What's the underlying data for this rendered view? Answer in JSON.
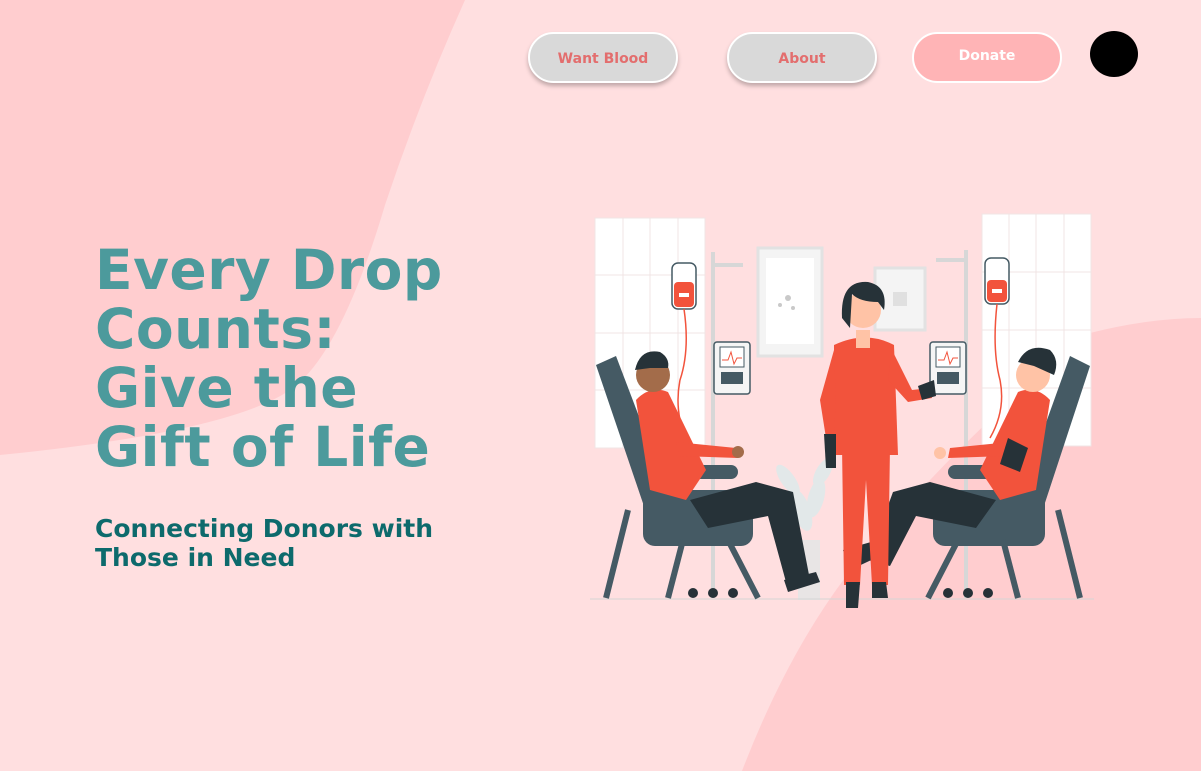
{
  "nav": {
    "want_blood_label": "Want Blood",
    "about_label": "About",
    "donate_label": "Donate"
  },
  "hero": {
    "headline_lines": [
      "Every Drop",
      "Counts:",
      "Give the",
      "Gift of Life"
    ],
    "subheadline_lines": [
      "Connecting Donors with",
      "Those in Need"
    ]
  },
  "illustration": {
    "name": "blood-donation-illustration",
    "blood_bag_label": ""
  },
  "colors": {
    "background": "#ffdfe0",
    "background_shape": "#ffcdcf",
    "headline": "#4c9a9c",
    "subheadline": "#0d6a6c",
    "nav_button_bg": "#d9d9d9",
    "nav_button_text": "#e36e6e",
    "donate_button_bg": "#ffb4b6",
    "accent_red": "#f2533c",
    "chair": "#455a64"
  }
}
